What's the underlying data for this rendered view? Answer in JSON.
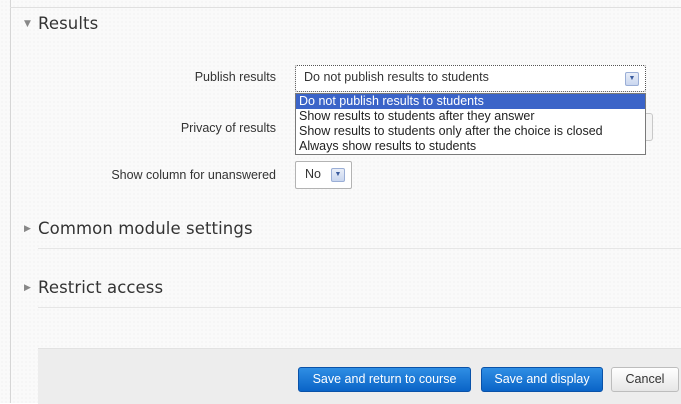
{
  "results_section": {
    "title": "Results",
    "publish": {
      "label": "Publish results",
      "selected": "Do not publish results to students",
      "options": [
        "Do not publish results to students",
        "Show results to students after they answer",
        "Show results to students only after the choice is closed",
        "Always show results to students"
      ]
    },
    "privacy": {
      "label": "Privacy of results"
    },
    "unanswered": {
      "label": "Show column for unanswered",
      "selected": "No"
    }
  },
  "sections": {
    "common": "Common module settings",
    "restrict": "Restrict access"
  },
  "buttons": {
    "save_return": "Save and return to course",
    "save_display": "Save and display",
    "cancel": "Cancel"
  },
  "colors": {
    "primary_button": "#0f6fd4",
    "selected_option": "#3b64c8"
  },
  "icons": {
    "expanded": "triangle-down-icon",
    "collapsed": "triangle-right-icon",
    "dropdown": "chevron-down-icon"
  }
}
